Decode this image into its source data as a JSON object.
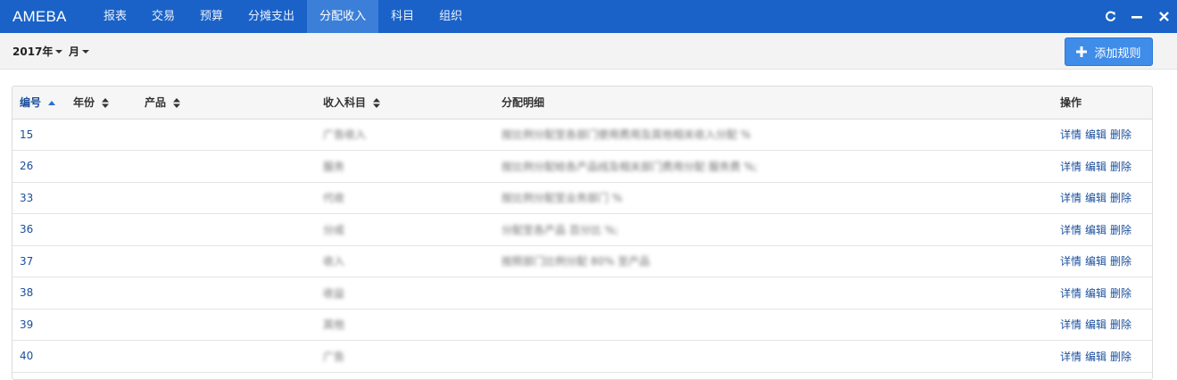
{
  "app": {
    "brand": "AMEBA"
  },
  "nav": {
    "items": [
      {
        "label": "报表",
        "active": false
      },
      {
        "label": "交易",
        "active": false
      },
      {
        "label": "预算",
        "active": false
      },
      {
        "label": "分摊支出",
        "active": false
      },
      {
        "label": "分配收入",
        "active": true
      },
      {
        "label": "科目",
        "active": false
      },
      {
        "label": "组织",
        "active": false
      }
    ]
  },
  "window_controls": {
    "icons": [
      "refresh-icon",
      "minimize-icon",
      "close-icon"
    ]
  },
  "filters": {
    "year": "2017年",
    "month": "月"
  },
  "toolbar": {
    "add_label": "添加规则"
  },
  "table": {
    "columns": [
      "编号",
      "年份",
      "产品",
      "收入科目",
      "分配明细",
      "操作"
    ],
    "sorted_column": "编号",
    "sort_direction": "asc",
    "actions": [
      "详情",
      "编辑",
      "删除"
    ],
    "rows": [
      {
        "id": "15",
        "year": "",
        "product": "",
        "account": "广告收入",
        "detail": "按比例分配至各部门使用费用及其他相关收入分配 %"
      },
      {
        "id": "26",
        "year": "",
        "product": "",
        "account": "服务",
        "detail": "按比例分配给各产品线及相关部门费用分配 服务费 %;"
      },
      {
        "id": "33",
        "year": "",
        "product": "",
        "account": "代收",
        "detail": "按比例分配至业务部门 %"
      },
      {
        "id": "36",
        "year": "",
        "product": "",
        "account": "分成",
        "detail": "分配至各产品 百分比 %;"
      },
      {
        "id": "37",
        "year": "",
        "product": "",
        "account": "收入",
        "detail": "按照部门比例分配 80% 至产品"
      },
      {
        "id": "38",
        "year": "",
        "product": "",
        "account": "收益",
        "detail": ""
      },
      {
        "id": "39",
        "year": "",
        "product": "",
        "account": "其他",
        "detail": ""
      },
      {
        "id": "40",
        "year": "",
        "product": "",
        "account": "广告",
        "detail": ""
      }
    ]
  },
  "colors": {
    "navbar": "#1a62c8",
    "nav_active": "#3c7fd8",
    "primary_button": "#3f8ce9",
    "link": "#1a4f9c"
  }
}
